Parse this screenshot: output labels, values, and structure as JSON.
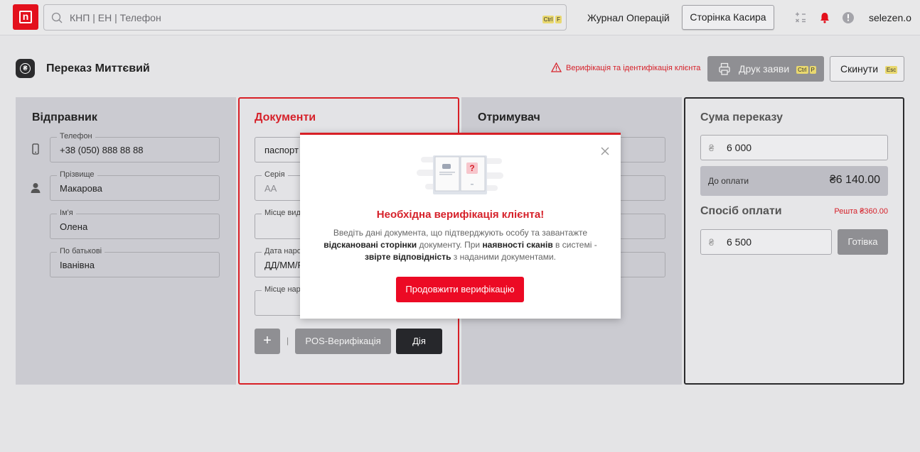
{
  "topbar": {
    "logo_letter": "n",
    "search_placeholder": "КНП | ЕН | Телефон",
    "search_kbd1": "Ctrl",
    "search_kbd2": "F",
    "journal_link": "Журнал Операцій",
    "cashier_button": "Сторінка Касира",
    "username": "selezen.o"
  },
  "header": {
    "title": "Переказ Миттєвий",
    "verification_warning": "Верифікація та ідентифікація клієнта",
    "print_button": "Друк заяви",
    "print_kbd1": "Ctrl",
    "print_kbd2": "P",
    "reset_button": "Скинути",
    "reset_kbd": "Esc"
  },
  "sender": {
    "title": "Відправник",
    "phone_label": "Телефон",
    "phone_value": "+38 (050) 888 88 88",
    "surname_label": "Прізвище",
    "surname_value": "Макарова",
    "name_label": "Ім'я",
    "name_value": "Олена",
    "patronymic_label": "По батькові",
    "patronymic_value": "Іванівна"
  },
  "documents": {
    "title": "Документи",
    "doc_type_value": "паспорт",
    "series_label": "Серія",
    "series_placeholder": "АА",
    "issue_place_label": "Місце вид",
    "birth_date_label": "Дата наро",
    "birth_date_placeholder": "ДД/ММ/Р",
    "birth_place_label": "Місце нар",
    "plus_button": "+",
    "separator": "|",
    "pos_button": "POS-Верифікація",
    "diia_button": "Дія"
  },
  "receiver": {
    "title": "Отримувач"
  },
  "summary": {
    "title": "Сума переказу",
    "currency_symbol": "₴",
    "amount": "6 000",
    "to_pay_label": "До оплати",
    "to_pay_value": "₴6 140.00",
    "payment_method_title": "Спосіб оплати",
    "change_label": "Решта ₴360.00",
    "paid_amount": "6 500",
    "cash_button": "Готівка"
  },
  "modal": {
    "title": "Необхідна верифікація клієнта!",
    "text_1": "Введіть дані документа, що підтверджують особу та завантажте ",
    "text_bold_1": "відскановані сторінки",
    "text_2": " документу. При ",
    "text_bold_2": "наявності сканів",
    "text_3": " в системі - ",
    "text_bold_3": "звірте відповідність",
    "text_4": " з наданими документами.",
    "button": "Продовжити верифікацію"
  },
  "colors": {
    "brand_red": "#e3101c",
    "warning_red": "#d6212a",
    "dark_button": "#26272b",
    "grey_button": "#8f8f93"
  }
}
